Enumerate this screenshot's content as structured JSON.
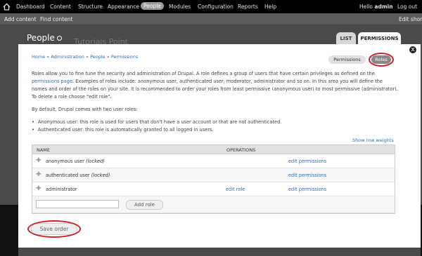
{
  "admin_menu": {
    "items": [
      "Dashboard",
      "Content",
      "Structure",
      "Appearance",
      "People",
      "Modules",
      "Configuration",
      "Reports",
      "Help"
    ],
    "active": "People",
    "greeting": "Hello",
    "username": "admin",
    "logout": "Log out"
  },
  "shortcuts": {
    "items": [
      "Add content",
      "Find content"
    ],
    "edit": "Edit short"
  },
  "page": {
    "title": "People",
    "watermark": "Tutorials Point",
    "tabs": [
      "LIST",
      "PERMISSIONS"
    ],
    "active_tab": "PERMISSIONS"
  },
  "overlay": {
    "close": "x",
    "breadcrumb": [
      "Home",
      "Administration",
      "People",
      "Permissions"
    ],
    "breadcrumb_sep": "»",
    "subtabs": [
      "Permissions",
      "Roles"
    ],
    "active_subtab": "Roles",
    "intro_1": "Roles allow you to fine tune the security and administration of Drupal. A role defines a group of users that have certain privileges as defined on the",
    "intro_link": "permissions page",
    "intro_2": ". Examples of roles include: anonymous user, authenticated user, moderator, administrator and so on. In this area you will define the names and order of the roles on your site. It is recommended to order your roles from least permissive (anonymous user) to most permissive (administrator). To delete a role choose \"edit role\".",
    "default_text": "By default, Drupal comes with two user roles:",
    "bullets": [
      "Anonymous user: this role is used for users that don't have a user account or that are not authenticated.",
      "Authenticated user: this role is automatically granted to all logged in users."
    ],
    "show_weights": "Show row weights",
    "table": {
      "headers": {
        "name": "NAME",
        "operations": "OPERATIONS"
      },
      "rows": [
        {
          "name": "anonymous user",
          "tag": "(locked)",
          "edit_role": "",
          "edit_permissions": "edit permissions"
        },
        {
          "name": "authenticated user",
          "tag": "(locked)",
          "edit_role": "",
          "edit_permissions": "edit permissions"
        },
        {
          "name": "administrator",
          "tag": "",
          "edit_role": "edit role",
          "edit_permissions": "edit permissions"
        }
      ],
      "new_role_value": "",
      "add_role": "Add role"
    },
    "save": "Save order"
  },
  "colors": {
    "link": "#2a6fb5",
    "highlight": "#d0202c",
    "toolbar": "#000000"
  }
}
